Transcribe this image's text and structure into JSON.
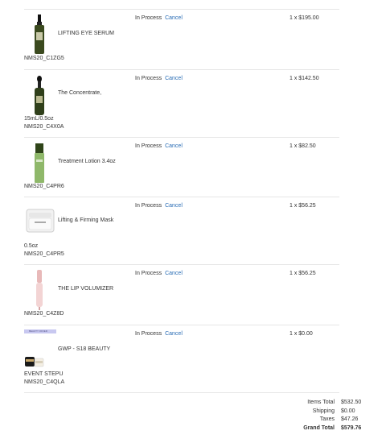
{
  "items": [
    {
      "name": "LIFTING EYE SERUM",
      "sku": "NMS20_C1ZG5",
      "status": "In Process",
      "cancel": "Cancel",
      "qty_price": "1 x $195.00",
      "thumb": "serum-bottle"
    },
    {
      "name": "The Concentrate,",
      "wrap": "15mL/0.5oz",
      "sku": "NMS20_C4X0A",
      "status": "In Process",
      "cancel": "Cancel",
      "qty_price": "1 x $142.50",
      "thumb": "dropper-bottle"
    },
    {
      "name": "Treatment Lotion 3.4oz",
      "sku": "NMS20_C4PR6",
      "status": "In Process",
      "cancel": "Cancel",
      "qty_price": "1 x $82.50",
      "thumb": "lotion-bottle"
    },
    {
      "name": "Lifting & Firming Mask",
      "wrap": "0.5oz",
      "sku": "NMS20_C4PR5",
      "status": "In Process",
      "cancel": "Cancel",
      "qty_price": "1 x $56.25",
      "thumb": "mask-jar"
    },
    {
      "name": "THE LIP VOLUMIZER",
      "sku": "NMS20_C4Z8D",
      "status": "In Process",
      "cancel": "Cancel",
      "qty_price": "1 x $56.25",
      "thumb": "lip-tube"
    },
    {
      "name": "GWP - S18 BEAUTY",
      "wrap": "EVENT STEPU",
      "sku": "NMS20_C4QLA",
      "status": "In Process",
      "cancel": "Cancel",
      "qty_price": "1 x $0.00",
      "thumb": "gift-set",
      "badge": "BEAUTY OFFER"
    }
  ],
  "totals": {
    "items_total_label": "Items Total",
    "items_total": "$532.50",
    "shipping_label": "Shipping",
    "shipping": "$0.00",
    "taxes_label": "Taxes",
    "taxes": "$47.26",
    "grand_total_label": "Grand Total",
    "grand_total": "$579.76"
  }
}
